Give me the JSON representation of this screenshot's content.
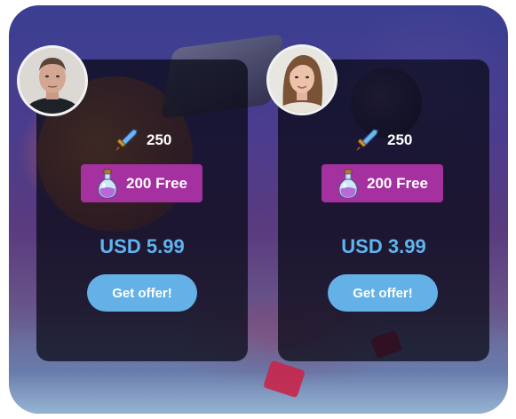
{
  "offers": [
    {
      "avatar": "male-player-avatar",
      "gems": "250",
      "gem_icon": "sword-icon",
      "free_label": "200 Free",
      "free_icon": "potion-icon",
      "price": "USD 5.99",
      "button_label": "Get offer!"
    },
    {
      "avatar": "female-player-avatar",
      "gems": "250",
      "gem_icon": "sword-icon",
      "free_label": "200 Free",
      "free_icon": "potion-icon",
      "price": "USD 3.99",
      "button_label": "Get offer!"
    }
  ],
  "colors": {
    "card_bg": "#080a16",
    "badge": "#a5309f",
    "price": "#60b4f0",
    "button": "#63b1e6"
  }
}
